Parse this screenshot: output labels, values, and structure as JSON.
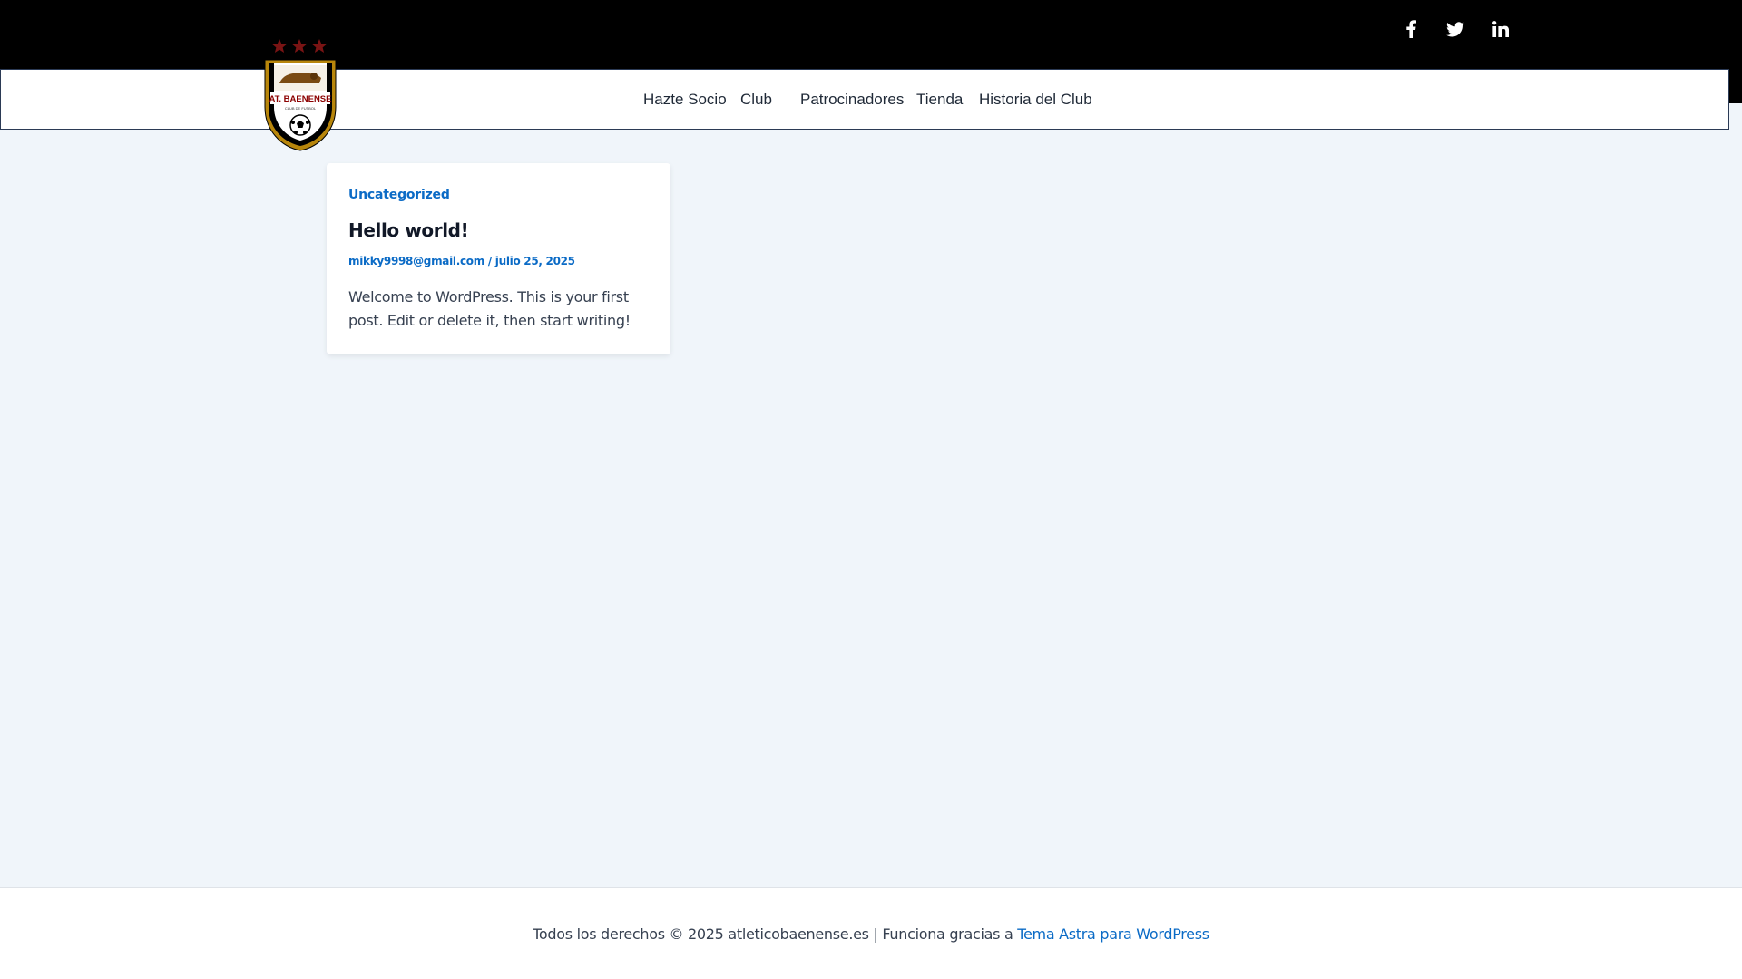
{
  "header": {
    "social": [
      {
        "name": "facebook",
        "icon": "facebook-icon"
      },
      {
        "name": "twitter",
        "icon": "twitter-icon"
      },
      {
        "name": "linkedin",
        "icon": "linkedin-icon"
      }
    ],
    "logo_text": "AT. BAENENSE",
    "logo_subtext": "CLUB DE FUTBOL",
    "nav": [
      {
        "label": "Hazte Socio"
      },
      {
        "label": "Club"
      },
      {
        "label": "Patrocinadores"
      },
      {
        "label": "Tienda"
      },
      {
        "label": "Historia del Club"
      }
    ]
  },
  "post": {
    "category": "Uncategorized",
    "title": "Hello world!",
    "author": "mikky9998@gmail.com",
    "separator": " / ",
    "date": "julio 25, 2025",
    "excerpt": "Welcome to WordPress. This is your first post. Edit or delete it, then start writing!"
  },
  "footer": {
    "text": "Todos los derechos © 2025 atleticobaenense.es | Funciona gracias a ",
    "link": "Tema Astra para WordPress"
  },
  "colors": {
    "accent": "#0b6bc6",
    "background": "#f0f5fa",
    "topbar": "#000000"
  }
}
